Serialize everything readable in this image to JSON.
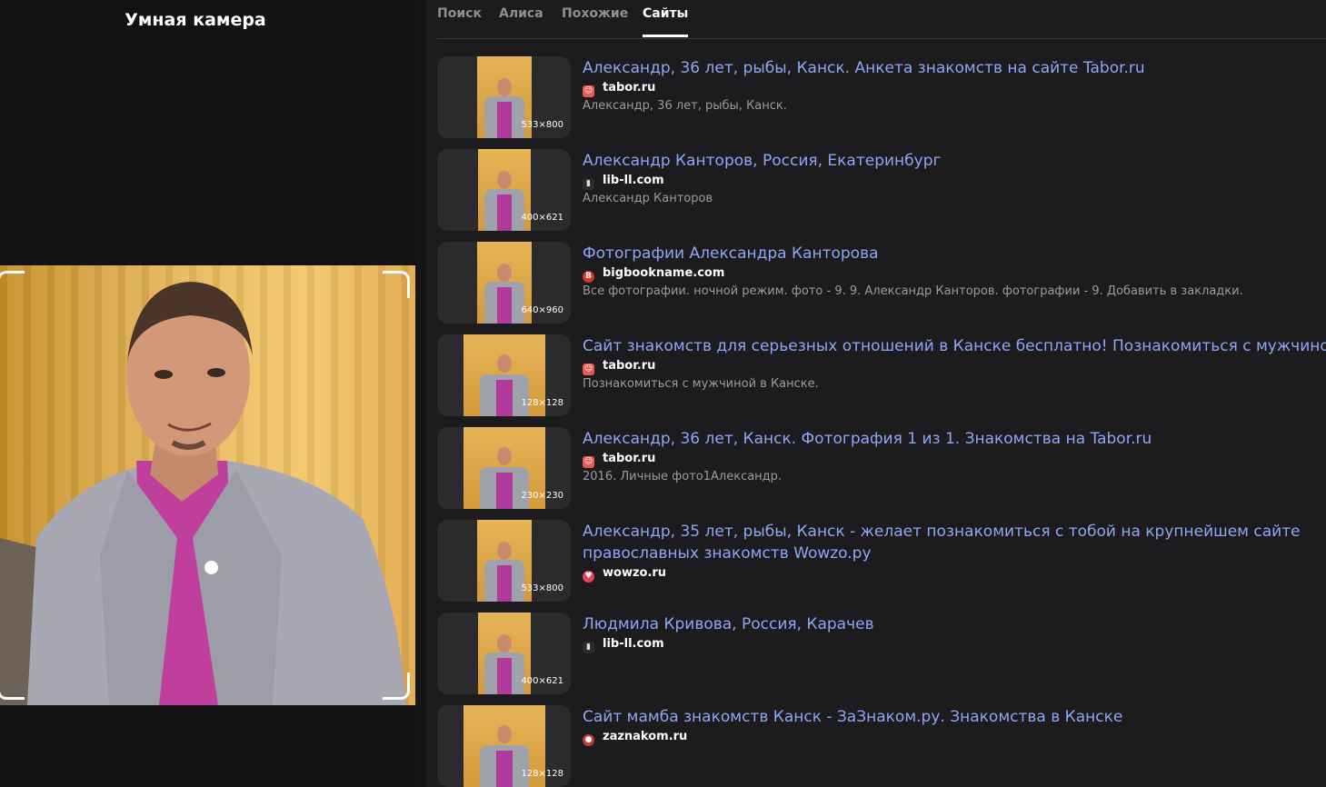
{
  "left_panel": {
    "title": "Умная камера"
  },
  "tabs": [
    {
      "label": "Поиск",
      "active": false
    },
    {
      "label": "Алиса",
      "active": false
    },
    {
      "label": "Похожие",
      "active": false
    },
    {
      "label": "Сайты",
      "active": true
    }
  ],
  "results": [
    {
      "title": "Александр, 36 лет, рыбы, Канск. Анкета знакомств на сайте Tabor.ru",
      "site": "tabor.ru",
      "favicon": "tabor-icon",
      "snippet": "Александр, 36 лет, рыбы, Канск.",
      "dims": "533×800"
    },
    {
      "title": "Александр Канторов, Россия, Екатеринбург",
      "site": "lib-ll.com",
      "favicon": "book-icon",
      "snippet": "Александр Канторов",
      "dims": "400×621"
    },
    {
      "title": "Фотографии Александра Канторова",
      "site": "bigbookname.com",
      "favicon": "bigbookname-icon",
      "snippet": "Все фотографии. ночной режим. фото - 9. 9. Александр Канторов. фотографии - 9. Добавить в закладки.",
      "dims": "640×960"
    },
    {
      "title": "Сайт знакомств для серьезных отношений в Канске бесплатно! Познакомиться с мужчиной в Канске",
      "site": "tabor.ru",
      "favicon": "tabor-icon",
      "snippet": "Познакомиться с мужчиной в Канске.",
      "dims": "128×128"
    },
    {
      "title": "Александр, 36 лет, Канск. Фотография 1 из 1. Знакомства на Tabor.ru",
      "site": "tabor.ru",
      "favicon": "tabor-icon",
      "snippet": "2016. Личные фото1Александр.",
      "dims": "230×230"
    },
    {
      "title": "Александр, 35 лет, рыбы, Канск - желает познакомиться с тобой на крупнейшем сайте православных знакомств Wowzo.ру",
      "site": "wowzo.ru",
      "favicon": "heart-icon",
      "snippet": "",
      "dims": "533×800"
    },
    {
      "title": "Людмила Кривова, Россия, Карачев",
      "site": "lib-ll.com",
      "favicon": "book-icon",
      "snippet": "",
      "dims": "400×621"
    },
    {
      "title": "Сайт мамба знакомств Канск - ЗаЗнаком.ру. Знакомства в Канске",
      "site": "zaznakom.ru",
      "favicon": "strawberry-icon",
      "snippet": "",
      "dims": "128×128"
    }
  ],
  "colors": {
    "link": "#8ea7f5",
    "snippet": "#9b9ba0",
    "panel": "#121212",
    "background": "#1c1c1e"
  }
}
